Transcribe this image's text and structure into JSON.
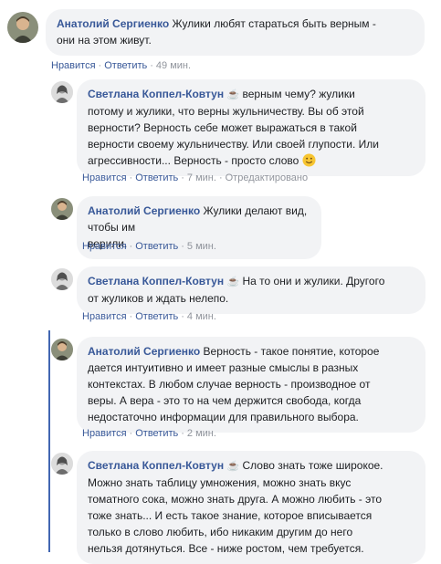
{
  "icons": {
    "coffee": "hot-beverage-icon",
    "smile": "smiling-face-icon"
  },
  "colors": {
    "author": "#385898",
    "bubble": "#f2f3f5",
    "meta": "#90949c",
    "thread_line": "#4267b2"
  },
  "comments": [
    {
      "author": "Анатолий Сергиенко",
      "lines": [
        "Жулики любят стараться быть верным -",
        "они на этом живут."
      ],
      "like": "Нравится",
      "reply": "Ответить",
      "time": "49 мин."
    },
    {
      "author": "Светлана Коппел-Ковтун",
      "coffee": "☕",
      "lines": [
        "верным чему? жулики",
        "потому и жулики, что верны жульничеству. Вы об этой",
        "верности? Верность себе может выражаться в такой",
        "верности своему жульничеству. Или своей глупости. Или",
        "агрессивности... Верность - просто слово"
      ],
      "like": "Нравится",
      "reply": "Ответить",
      "time": "7 мин.",
      "edited": "Отредактировано"
    },
    {
      "author": "Анатолий Сергиенко",
      "lines": [
        "Жулики делают вид, чтобы им",
        "верили."
      ],
      "like": "Нравится",
      "reply": "Ответить",
      "time": "5 мин."
    },
    {
      "author": "Светлана Коппел-Ковтун",
      "coffee": "☕",
      "lines": [
        "На то они и жулики. Другого",
        "от жуликов и ждать нелепо."
      ],
      "like": "Нравится",
      "reply": "Ответить",
      "time": "4 мин."
    },
    {
      "author": "Анатолий Сергиенко",
      "lines": [
        "Верность - такое понятие, которое",
        "дается интуитивно и имеет разные смыслы в разных",
        "контекстах. В любом случае верность - производное от",
        "веры. А вера - это то на чем держится свобода, когда",
        "недостаточно информации для правильного выбора."
      ],
      "like": "Нравится",
      "reply": "Ответить",
      "time": "2 мин."
    },
    {
      "author": "Светлана Коппел-Ковтун",
      "coffee": "☕",
      "lines": [
        "Слово знать тоже широкое.",
        "Можно знать таблицу умножения, можно знать вкус",
        "томатного сока, можно знать друга. А можно любить - это",
        "тоже знать... И есть такое знание, которое вписывается",
        "только в слово любить, ибо никаким другим до него",
        "нельзя дотянуться. Все - ниже ростом, чем требуется."
      ]
    }
  ]
}
